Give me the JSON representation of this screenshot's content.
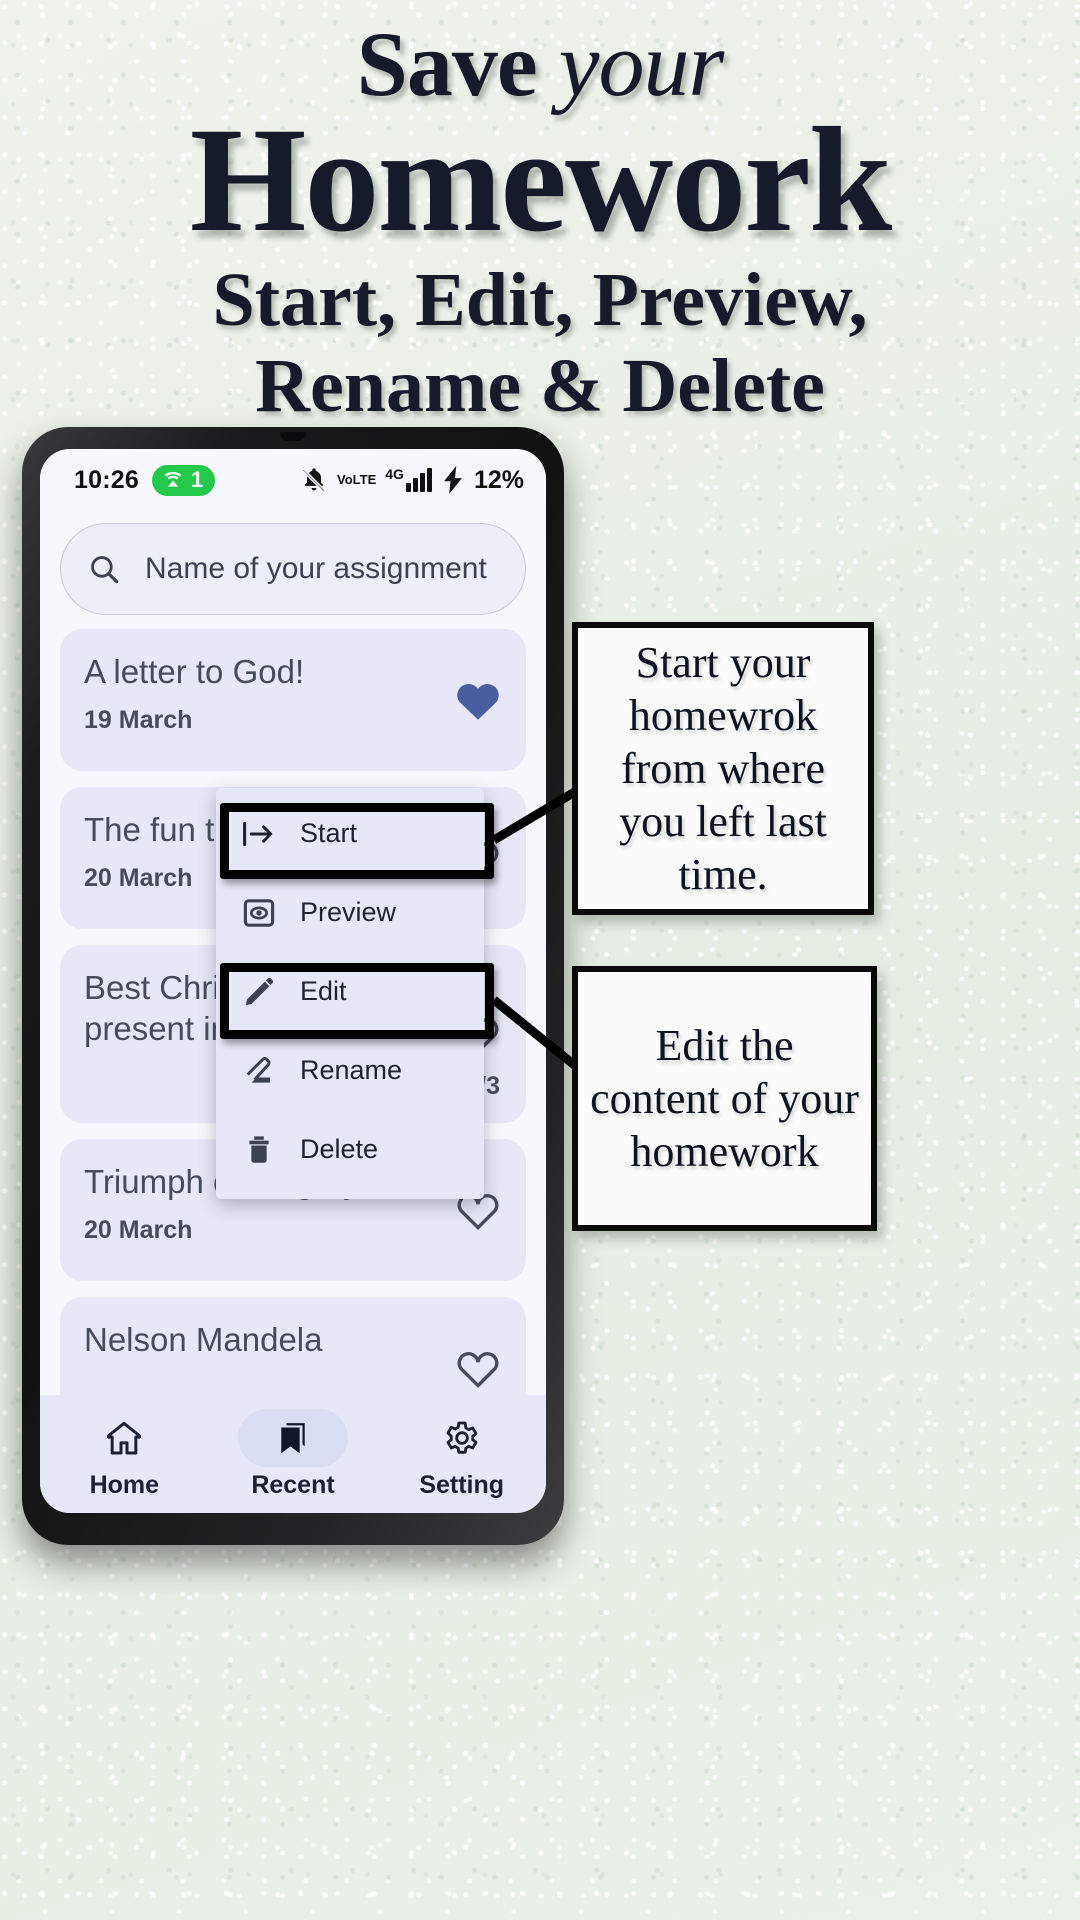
{
  "promo": {
    "headline_line1_bold": "Save",
    "headline_line1_italic": "your",
    "headline_line2": "Homework",
    "headline_line3": "Start, Edit, Preview,",
    "headline_line4": "Rename & Delete"
  },
  "callouts": [
    {
      "id": "start",
      "text": "Start your homewrok from where you left last time."
    },
    {
      "id": "edit",
      "text": "Edit the content of your homework"
    }
  ],
  "phone": {
    "status_bar": {
      "time": "10:26",
      "hotspot_count": "1",
      "hotspot_icon": "wifi-tethering-icon",
      "mute_icon": "bell-off-icon",
      "volte_top": "Vo",
      "volte_bottom": "LTE",
      "network_type": "4G",
      "signal_icon": "signal-bars-icon",
      "charging_icon": "bolt-icon",
      "battery_percent": "12%"
    },
    "search": {
      "icon": "search-icon",
      "placeholder": "Name of your assignment",
      "value": ""
    },
    "assignments": [
      {
        "title": "A letter to God!",
        "date": "19 March",
        "favorite": true,
        "fav_icon": "heart-filled-icon"
      },
      {
        "title": "The fun they had",
        "date": "20 March",
        "favorite": false,
        "fav_icon": "heart-outline-icon"
      },
      {
        "title": "Best Christmas present in the world",
        "date": "21/3",
        "favorite": false,
        "fav_icon": "heart-outline-icon"
      },
      {
        "title": "Triumph of surgery",
        "date": "20 March",
        "favorite": false,
        "fav_icon": "heart-outline-icon"
      },
      {
        "title": "Nelson Mandela",
        "date": "",
        "favorite": false,
        "fav_icon": "heart-outline-icon"
      }
    ],
    "context_menu": {
      "items": [
        {
          "label": "Start",
          "icon": "start-arrow-icon",
          "highlighted": true
        },
        {
          "label": "Preview",
          "icon": "eye-box-icon",
          "highlighted": false
        },
        {
          "label": "Edit",
          "icon": "pencil-icon",
          "highlighted": true
        },
        {
          "label": "Rename",
          "icon": "rename-pencil-icon",
          "highlighted": false
        },
        {
          "label": "Delete",
          "icon": "trash-icon",
          "highlighted": false
        }
      ]
    },
    "bottom_nav": [
      {
        "label": "Home",
        "icon": "home-icon",
        "active": false
      },
      {
        "label": "Recent",
        "icon": "bookmarks-icon",
        "active": true
      },
      {
        "label": "Setting",
        "icon": "gear-icon",
        "active": false
      }
    ]
  },
  "colors": {
    "background": "#e9f0e7",
    "headline_text": "#151b2b",
    "card_bg": "#e6e8f7",
    "screen_bg": "#f7f8fd",
    "accent_heart": "#4a5d9e",
    "hotspot_green": "#24c84a",
    "text_primary": "#474c5c"
  }
}
